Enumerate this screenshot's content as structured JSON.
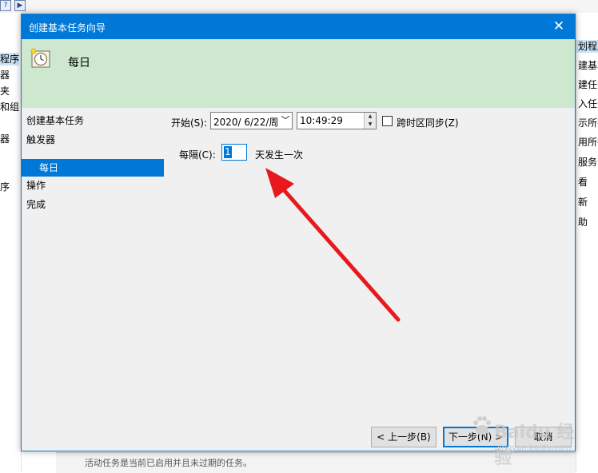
{
  "background": {
    "left_items": [
      "程序",
      "器",
      "夹",
      "和组",
      "器",
      "序"
    ],
    "right_items": [
      "划程序",
      "建基本",
      "建任务",
      "入任务",
      "示所有",
      "用所有",
      "服务",
      "看",
      "新",
      "助"
    ],
    "bottom_text": "活动任务是当前已启用并且未过期的任务。"
  },
  "dialog": {
    "title": "创建基本任务向导",
    "close_glyph": "✕",
    "header_title": "每日",
    "nav": [
      "创建基本任务",
      "触发器",
      "每日",
      "操作",
      "完成"
    ],
    "start_label": "开始(S):",
    "date_value": "2020/ 6/22/周",
    "time_value": "10:49:29",
    "sync_label": "跨时区同步(Z)",
    "sync_checked": false,
    "interval_label": "每隔(C):",
    "interval_value": "1",
    "interval_suffix": "天发生一次",
    "back_button": "< 上一步(B)",
    "next_button": "下一步(N) >",
    "cancel_button": "取消"
  },
  "annotation": {
    "arrow_color": "#e8191c"
  },
  "watermark": {
    "main": "Baidu 经验",
    "sub": "jingyan.baidu.com"
  },
  "colors": {
    "title_bar": "#0078d7",
    "header_bg": "#cde8cf",
    "selection": "#0078d7"
  }
}
